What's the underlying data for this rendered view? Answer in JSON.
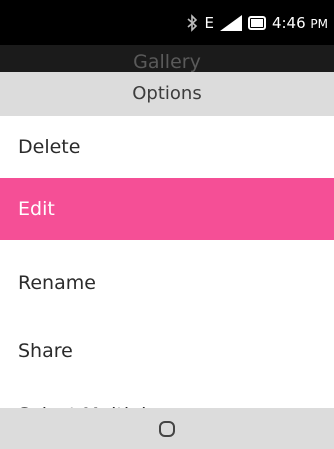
{
  "status_bar": {
    "network": "E",
    "time": "4:46",
    "ampm": "PM",
    "icons": [
      "bluetooth-icon",
      "signal-icon",
      "battery-icon"
    ]
  },
  "background_app": {
    "title": "Gallery"
  },
  "options": {
    "header": "Options",
    "items": [
      {
        "label": "Delete"
      },
      {
        "label": "Edit",
        "selected": true
      },
      {
        "label": "Rename"
      },
      {
        "label": "Share"
      },
      {
        "label": "Select Multiple"
      }
    ]
  },
  "softkey": {
    "center_icon": "select-circle-icon"
  },
  "colors": {
    "accent": "#f54f96",
    "header_bg": "#dcdcdc",
    "status_bg": "#000000"
  }
}
